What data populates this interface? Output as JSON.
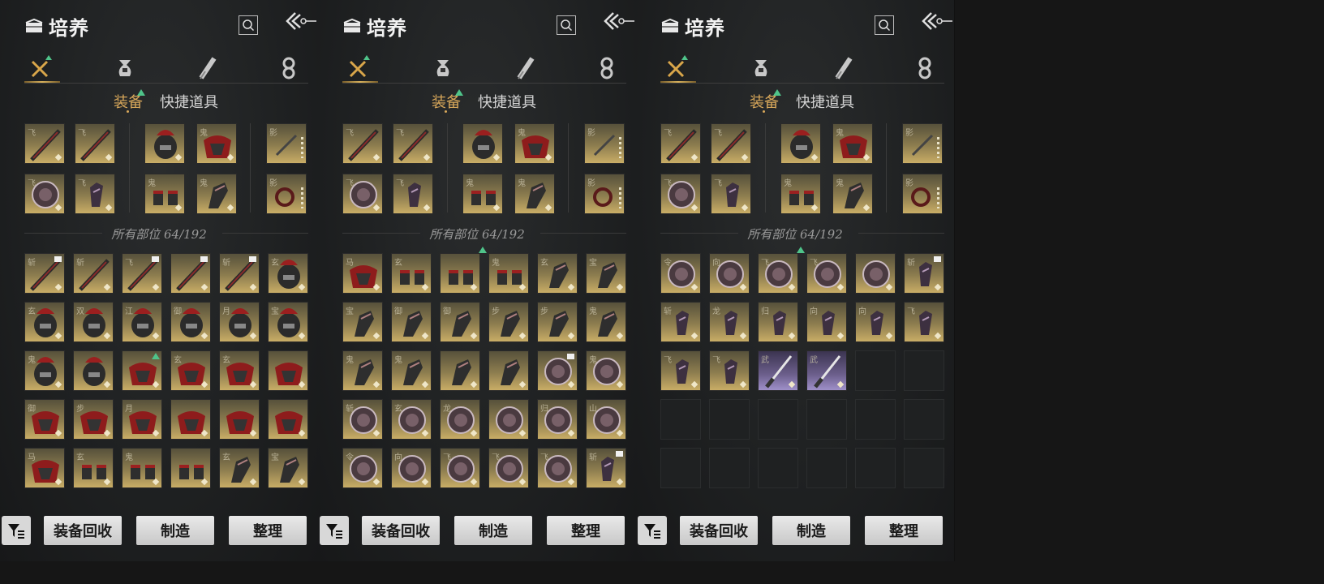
{
  "app": {
    "title": "培养"
  },
  "subtabs": {
    "active": "装备",
    "inactive": "快捷道具"
  },
  "count_label": "所有部位 64/192",
  "buttons": {
    "recycle": "装备回收",
    "craft": "制造",
    "sort": "整理"
  },
  "icons": {
    "title": "bag-icon",
    "search": "search-icon",
    "back": "back-arrow-icon",
    "tabs": [
      "equipment-tab-icon",
      "pouch-tab-icon",
      "scroll-tab-icon",
      "ring-tab-icon"
    ],
    "filter": "filter-icon"
  },
  "colors": {
    "accent": "#d7a75a",
    "new_marker": "#4fc48a",
    "slot_gold": "#c9ad66",
    "slot_purple": "#9f90c9"
  },
  "panels": [
    {
      "equipped": [
        {
          "glyph": "飞",
          "kind": "weapon"
        },
        {
          "glyph": "飞",
          "kind": "weapon"
        },
        {
          "glyph": "",
          "kind": "helm"
        },
        {
          "glyph": "鬼",
          "kind": "cloth"
        },
        {
          "glyph": "影",
          "kind": "misc"
        },
        {
          "glyph": "飞",
          "kind": "disc"
        },
        {
          "glyph": "飞",
          "kind": "vambrace"
        },
        {
          "glyph": "鬼",
          "kind": "gauntlet"
        },
        {
          "glyph": "鬼",
          "kind": "greave"
        },
        {
          "glyph": "影",
          "kind": "bead"
        }
      ],
      "inventory": [
        {
          "glyph": "斩",
          "kind": "spear",
          "tag": true
        },
        {
          "glyph": "斩",
          "kind": "spear"
        },
        {
          "glyph": "飞",
          "kind": "spear",
          "tag": true
        },
        {
          "glyph": "",
          "kind": "spear",
          "tag": true
        },
        {
          "glyph": "斩",
          "kind": "spear",
          "tag": true
        },
        {
          "glyph": "玄",
          "kind": "helm"
        },
        {
          "glyph": "玄",
          "kind": "helm"
        },
        {
          "glyph": "双",
          "kind": "helm"
        },
        {
          "glyph": "江",
          "kind": "helm"
        },
        {
          "glyph": "御",
          "kind": "helm"
        },
        {
          "glyph": "月",
          "kind": "helm"
        },
        {
          "glyph": "宝",
          "kind": "helm"
        },
        {
          "glyph": "鬼",
          "kind": "helm"
        },
        {
          "glyph": "",
          "kind": "helm"
        },
        {
          "glyph": "",
          "kind": "cloth",
          "new": true
        },
        {
          "glyph": "玄",
          "kind": "cloth"
        },
        {
          "glyph": "玄",
          "kind": "cloth"
        },
        {
          "glyph": "",
          "kind": "cloth"
        },
        {
          "glyph": "御",
          "kind": "cloth"
        },
        {
          "glyph": "步",
          "kind": "cloth"
        },
        {
          "glyph": "月",
          "kind": "cloth"
        },
        {
          "glyph": "",
          "kind": "cloth"
        },
        {
          "glyph": "",
          "kind": "cloth"
        },
        {
          "glyph": "",
          "kind": "cloth"
        },
        {
          "glyph": "马",
          "kind": "cloth"
        },
        {
          "glyph": "玄",
          "kind": "gauntlet"
        },
        {
          "glyph": "鬼",
          "kind": "gauntlet"
        },
        {
          "glyph": "",
          "kind": "gauntlet"
        },
        {
          "glyph": "玄",
          "kind": "greave"
        },
        {
          "glyph": "宝",
          "kind": "greave"
        }
      ]
    },
    {
      "equipped": [
        {
          "glyph": "飞",
          "kind": "weapon"
        },
        {
          "glyph": "飞",
          "kind": "weapon"
        },
        {
          "glyph": "",
          "kind": "helm"
        },
        {
          "glyph": "鬼",
          "kind": "cloth"
        },
        {
          "glyph": "影",
          "kind": "misc"
        },
        {
          "glyph": "飞",
          "kind": "disc"
        },
        {
          "glyph": "飞",
          "kind": "vambrace"
        },
        {
          "glyph": "鬼",
          "kind": "gauntlet"
        },
        {
          "glyph": "鬼",
          "kind": "greave"
        },
        {
          "glyph": "影",
          "kind": "bead"
        }
      ],
      "inventory": [
        {
          "glyph": "马",
          "kind": "cloth"
        },
        {
          "glyph": "玄",
          "kind": "gauntlet"
        },
        {
          "glyph": "",
          "kind": "gauntlet"
        },
        {
          "glyph": "鬼",
          "kind": "gauntlet"
        },
        {
          "glyph": "玄",
          "kind": "greave"
        },
        {
          "glyph": "宝",
          "kind": "greave"
        },
        {
          "glyph": "宝",
          "kind": "greave"
        },
        {
          "glyph": "御",
          "kind": "greave"
        },
        {
          "glyph": "御",
          "kind": "greave"
        },
        {
          "glyph": "步",
          "kind": "greave"
        },
        {
          "glyph": "步",
          "kind": "greave"
        },
        {
          "glyph": "鬼",
          "kind": "greave"
        },
        {
          "glyph": "鬼",
          "kind": "greave"
        },
        {
          "glyph": "鬼",
          "kind": "greave"
        },
        {
          "glyph": "",
          "kind": "greave"
        },
        {
          "glyph": "",
          "kind": "greave"
        },
        {
          "glyph": "",
          "kind": "disc",
          "tag": true
        },
        {
          "glyph": "鬼",
          "kind": "disc"
        },
        {
          "glyph": "斩",
          "kind": "disc"
        },
        {
          "glyph": "玄",
          "kind": "disc"
        },
        {
          "glyph": "龙",
          "kind": "disc"
        },
        {
          "glyph": "",
          "kind": "disc"
        },
        {
          "glyph": "归",
          "kind": "disc"
        },
        {
          "glyph": "山",
          "kind": "disc"
        },
        {
          "glyph": "令",
          "kind": "disc"
        },
        {
          "glyph": "向",
          "kind": "disc"
        },
        {
          "glyph": "飞",
          "kind": "disc"
        },
        {
          "glyph": "飞",
          "kind": "disc"
        },
        {
          "glyph": "飞",
          "kind": "disc"
        },
        {
          "glyph": "斩",
          "kind": "vambrace",
          "tag": true
        }
      ]
    },
    {
      "equipped": [
        {
          "glyph": "飞",
          "kind": "weapon"
        },
        {
          "glyph": "飞",
          "kind": "weapon"
        },
        {
          "glyph": "",
          "kind": "helm"
        },
        {
          "glyph": "鬼",
          "kind": "cloth"
        },
        {
          "glyph": "影",
          "kind": "misc"
        },
        {
          "glyph": "飞",
          "kind": "disc"
        },
        {
          "glyph": "飞",
          "kind": "vambrace"
        },
        {
          "glyph": "鬼",
          "kind": "gauntlet"
        },
        {
          "glyph": "鬼",
          "kind": "greave"
        },
        {
          "glyph": "影",
          "kind": "bead"
        }
      ],
      "inventory": [
        {
          "glyph": "令",
          "kind": "disc"
        },
        {
          "glyph": "向",
          "kind": "disc"
        },
        {
          "glyph": "飞",
          "kind": "disc"
        },
        {
          "glyph": "飞",
          "kind": "disc"
        },
        {
          "glyph": "",
          "kind": "disc"
        },
        {
          "glyph": "斩",
          "kind": "vambrace",
          "tag": true
        },
        {
          "glyph": "斩",
          "kind": "vambrace"
        },
        {
          "glyph": "龙",
          "kind": "vambrace"
        },
        {
          "glyph": "归",
          "kind": "vambrace"
        },
        {
          "glyph": "向",
          "kind": "vambrace"
        },
        {
          "glyph": "向",
          "kind": "vambrace"
        },
        {
          "glyph": "飞",
          "kind": "vambrace"
        },
        {
          "glyph": "飞",
          "kind": "vambrace"
        },
        {
          "glyph": "飞",
          "kind": "vambrace"
        },
        {
          "glyph": "武",
          "kind": "blade",
          "rarity": "purple"
        },
        {
          "glyph": "武",
          "kind": "blade",
          "rarity": "purple"
        },
        {
          "empty": true
        },
        {
          "empty": true
        },
        {
          "empty": true
        },
        {
          "empty": true
        },
        {
          "empty": true
        },
        {
          "empty": true
        },
        {
          "empty": true
        },
        {
          "empty": true
        },
        {
          "empty": true
        },
        {
          "empty": true
        },
        {
          "empty": true
        },
        {
          "empty": true
        },
        {
          "empty": true
        },
        {
          "empty": true
        }
      ]
    }
  ]
}
